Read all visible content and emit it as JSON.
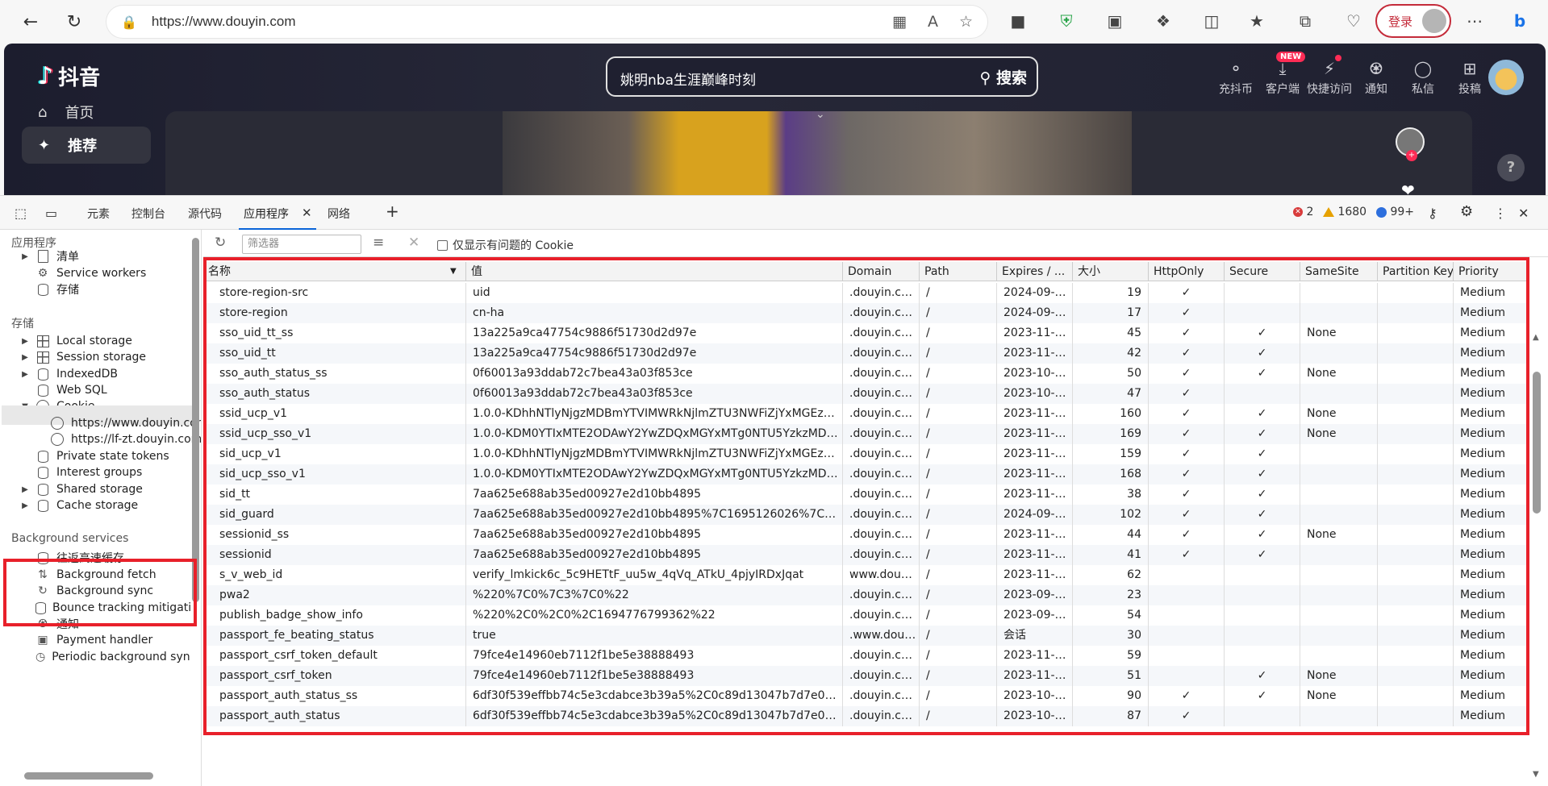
{
  "browser": {
    "url": "https://www.douyin.com",
    "login_label": "登录"
  },
  "page": {
    "logo_text": "抖音",
    "search_query": "姚明nba生涯巅峰时刻",
    "search_button": "搜索",
    "top_icons": [
      {
        "label": "充抖币",
        "icon": "coin-icon"
      },
      {
        "label": "客户端",
        "icon": "download-icon"
      },
      {
        "label": "快捷访问",
        "icon": "bolt-icon"
      },
      {
        "label": "通知",
        "icon": "bell-icon"
      },
      {
        "label": "私信",
        "icon": "message-icon"
      },
      {
        "label": "投稿",
        "icon": "upload-icon"
      }
    ],
    "new_badge": "NEW",
    "side_nav": [
      {
        "label": "首页",
        "icon": "home-icon"
      },
      {
        "label": "推荐",
        "icon": "sparkle-icon"
      }
    ],
    "help": "?"
  },
  "devtools": {
    "tabs": [
      "元素",
      "控制台",
      "源代码",
      "应用程序",
      "网络"
    ],
    "active_tab": "应用程序",
    "errors": "2",
    "warnings": "1680",
    "infos": "99+",
    "sidebar": {
      "app_header": "应用程序",
      "app_items": [
        "清单",
        "Service workers",
        "存储"
      ],
      "storage_header": "存储",
      "storage_items": [
        "Local storage",
        "Session storage",
        "IndexedDB",
        "Web SQL",
        "Cookie"
      ],
      "cookie_children": [
        "https://www.douyin.com",
        "https://lf-zt.douyin.com"
      ],
      "storage_items_after": [
        "Private state tokens",
        "Interest groups",
        "Shared storage",
        "Cache storage"
      ],
      "bg_header": "Background services",
      "bg_items": [
        "往返高速缓存",
        "Background fetch",
        "Background sync",
        "Bounce tracking mitigations",
        "通知",
        "Payment handler",
        "Periodic background sync"
      ]
    },
    "toolbar": {
      "filter_placeholder": "筛选器",
      "only_issues_label": "仅显示有问题的 Cookie"
    },
    "table": {
      "columns": [
        "名称",
        "值",
        "Domain",
        "Path",
        "Expires / ...",
        "大小",
        "HttpOnly",
        "Secure",
        "SameSite",
        "Partition Key",
        "Priority"
      ],
      "rows": [
        [
          "store-region-src",
          "uid",
          ".douyin.com",
          "/",
          "2024-09-1...",
          "19",
          "✓",
          "",
          "",
          "",
          "Medium"
        ],
        [
          "store-region",
          "cn-ha",
          ".douyin.com",
          "/",
          "2024-09-1...",
          "17",
          "✓",
          "",
          "",
          "",
          "Medium"
        ],
        [
          "sso_uid_tt_ss",
          "13a225a9ca47754c9886f51730d2d97e",
          ".douyin.com",
          "/",
          "2023-11-1...",
          "45",
          "✓",
          "✓",
          "None",
          "",
          "Medium"
        ],
        [
          "sso_uid_tt",
          "13a225a9ca47754c9886f51730d2d97e",
          ".douyin.com",
          "/",
          "2023-11-1...",
          "42",
          "✓",
          "✓",
          "",
          "",
          "Medium"
        ],
        [
          "sso_auth_status_ss",
          "0f60013a93ddab72c7bea43a03f853ce",
          ".douyin.com",
          "/",
          "2023-10-1...",
          "50",
          "✓",
          "✓",
          "None",
          "",
          "Medium"
        ],
        [
          "sso_auth_status",
          "0f60013a93ddab72c7bea43a03f853ce",
          ".douyin.com",
          "/",
          "2023-10-1...",
          "47",
          "✓",
          "",
          "",
          "",
          "Medium"
        ],
        [
          "ssid_ucp_v1",
          "1.0.0-KDhhNTlyNjgzMDBmYTVIMWRkNjlmZTU3NWFiZjYxMGEzZj...",
          ".douyin.com",
          "/",
          "2023-11-1...",
          "160",
          "✓",
          "✓",
          "None",
          "",
          "Medium"
        ],
        [
          "ssid_ucp_sso_v1",
          "1.0.0-KDM0YTIxMTE2ODAwY2YwZDQxMGYxMTg0NTU5YzkzMDRj...",
          ".douyin.com",
          "/",
          "2023-11-1...",
          "169",
          "✓",
          "✓",
          "None",
          "",
          "Medium"
        ],
        [
          "sid_ucp_v1",
          "1.0.0-KDhhNTlyNjgzMDBmYTVIMWRkNjlmZTU3NWFiZjYxMGEzZj...",
          ".douyin.com",
          "/",
          "2023-11-1...",
          "159",
          "✓",
          "✓",
          "",
          "",
          "Medium"
        ],
        [
          "sid_ucp_sso_v1",
          "1.0.0-KDM0YTIxMTE2ODAwY2YwZDQxMGYxMTg0NTU5YzkzMDRj...",
          ".douyin.com",
          "/",
          "2023-11-1...",
          "168",
          "✓",
          "✓",
          "",
          "",
          "Medium"
        ],
        [
          "sid_tt",
          "7aa625e688ab35ed00927e2d10bb4895",
          ".douyin.com",
          "/",
          "2023-11-1...",
          "38",
          "✓",
          "✓",
          "",
          "",
          "Medium"
        ],
        [
          "sid_guard",
          "7aa625e688ab35ed00927e2d10bb4895%7C1695126026%7C5183...",
          ".douyin.com",
          "/",
          "2024-09-1...",
          "102",
          "✓",
          "✓",
          "",
          "",
          "Medium"
        ],
        [
          "sessionid_ss",
          "7aa625e688ab35ed00927e2d10bb4895",
          ".douyin.com",
          "/",
          "2023-11-1...",
          "44",
          "✓",
          "✓",
          "None",
          "",
          "Medium"
        ],
        [
          "sessionid",
          "7aa625e688ab35ed00927e2d10bb4895",
          ".douyin.com",
          "/",
          "2023-11-1...",
          "41",
          "✓",
          "✓",
          "",
          "",
          "Medium"
        ],
        [
          "s_v_web_id",
          "verify_lmkick6c_5c9HETtF_uu5w_4qVq_ATkU_4pjyIRDxJqat",
          "www.douyi...",
          "/",
          "2023-11-1...",
          "62",
          "",
          "",
          "",
          "",
          "Medium"
        ],
        [
          "pwa2",
          "%220%7C0%7C3%7C0%22",
          ".douyin.com",
          "/",
          "2023-09-2...",
          "23",
          "",
          "",
          "",
          "",
          "Medium"
        ],
        [
          "publish_badge_show_info",
          "%220%2C0%2C0%2C1694776799362%22",
          ".douyin.com",
          "/",
          "2023-09-2...",
          "54",
          "",
          "",
          "",
          "",
          "Medium"
        ],
        [
          "passport_fe_beating_status",
          "true",
          ".www.douy...",
          "/",
          "会话",
          "30",
          "",
          "",
          "",
          "",
          "Medium"
        ],
        [
          "passport_csrf_token_default",
          "79fce4e14960eb7112f1be5e38888493",
          ".douyin.com",
          "/",
          "2023-11-1...",
          "59",
          "",
          "",
          "",
          "",
          "Medium"
        ],
        [
          "passport_csrf_token",
          "79fce4e14960eb7112f1be5e38888493",
          ".douyin.com",
          "/",
          "2023-11-1...",
          "51",
          "",
          "✓",
          "None",
          "",
          "Medium"
        ],
        [
          "passport_auth_status_ss",
          "6df30f539effbb74c5e3cdabce3b39a5%2C0c89d13047b7d7e0826f...",
          ".douyin.com",
          "/",
          "2023-10-1...",
          "90",
          "✓",
          "✓",
          "None",
          "",
          "Medium"
        ],
        [
          "passport_auth_status",
          "6df30f539effbb74c5e3cdabce3b39a5%2C0c89d13047b7d7e0826f...",
          ".douyin.com",
          "/",
          "2023-10-1...",
          "87",
          "✓",
          "",
          "",
          "",
          "Medium"
        ]
      ]
    }
  }
}
